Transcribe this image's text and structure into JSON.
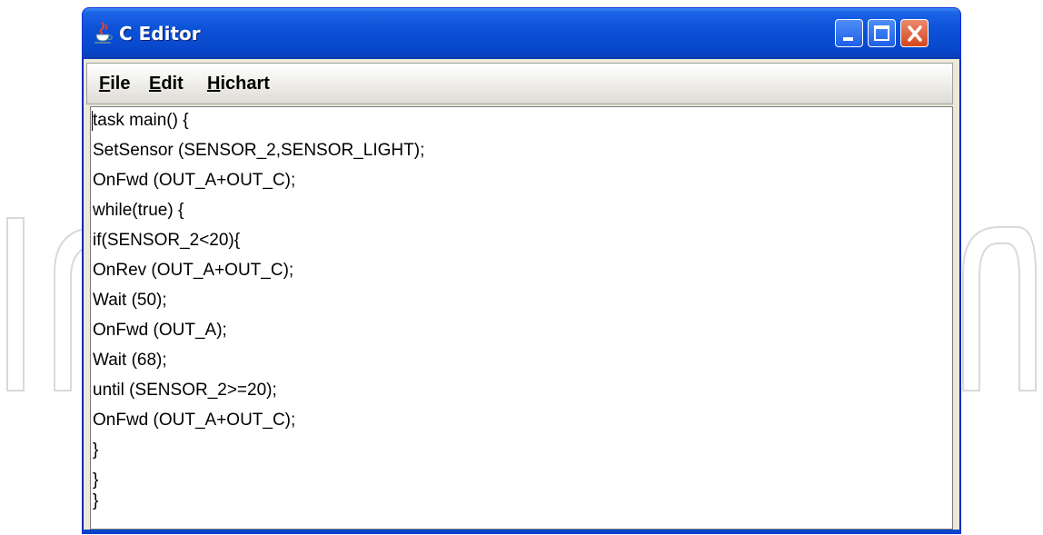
{
  "window": {
    "title": "C Editor",
    "icon": "java-cup-icon"
  },
  "controls": {
    "minimize_icon": "minimize-icon",
    "maximize_icon": "maximize-icon",
    "close_icon": "close-icon"
  },
  "menu": {
    "items": [
      {
        "mnemonic": "F",
        "rest": "ile"
      },
      {
        "mnemonic": "E",
        "rest": "dit"
      },
      {
        "mnemonic": "H",
        "rest": "ichart"
      }
    ]
  },
  "editor": {
    "lines": [
      "task main() {",
      "SetSensor (SENSOR_2,SENSOR_LIGHT);",
      "OnFwd (OUT_A+OUT_C);",
      "while(true) {",
      "if(SENSOR_2<20){",
      "OnRev (OUT_A+OUT_C);",
      "Wait (50);",
      "OnFwd (OUT_A);",
      "Wait (68);",
      "until (SENSOR_2>=20);",
      "OnFwd (OUT_A+OUT_C);",
      "}",
      "}",
      "}"
    ]
  },
  "colors": {
    "titlebar": "#0c52d8",
    "close_button": "#d4461e"
  }
}
